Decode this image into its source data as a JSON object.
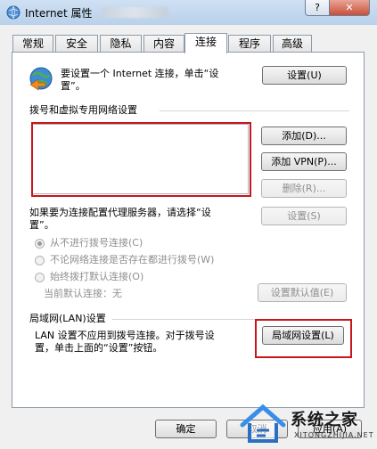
{
  "window": {
    "title": "Internet 属性",
    "help_label": "?",
    "close_label": "✕"
  },
  "tabs": [
    {
      "label": "常规"
    },
    {
      "label": "安全"
    },
    {
      "label": "隐私"
    },
    {
      "label": "内容"
    },
    {
      "label": "连接",
      "active": true
    },
    {
      "label": "程序"
    },
    {
      "label": "高级"
    }
  ],
  "setup": {
    "text_line1": "要设置一个 Internet 连接，单击“设",
    "text_line2": "置”。",
    "button": "设置(U)"
  },
  "dialup": {
    "heading": "拨号和虚拟专用网络设置",
    "add_button": "添加(D)...",
    "add_vpn_button": "添加 VPN(P)...",
    "remove_button": "删除(R)...",
    "proxy_text_line1": "如果要为连接配置代理服务器，请选择“设",
    "proxy_text_line2": "置”。",
    "settings_button": "设置(S)",
    "options": [
      {
        "label": "从不进行拨号连接(C)",
        "checked": true
      },
      {
        "label": "不论网络连接是否存在都进行拨号(W)",
        "checked": false
      },
      {
        "label": "始终拨打默认连接(O)",
        "checked": false
      }
    ],
    "current_default_label": "当前默认连接：",
    "current_default_value": "无",
    "set_default_button": "设置默认值(E)"
  },
  "lan": {
    "heading": "局域网(LAN)设置",
    "text_line1": "LAN 设置不应用到拨号连接。对于拨号设",
    "text_line2": "置，单击上面的“设置”按钮。",
    "button": "局域网设置(L)"
  },
  "footer": {
    "ok": "确定",
    "cancel": "取消",
    "apply": "应用(A)"
  },
  "watermark": {
    "text": "系统之家",
    "sub": "XITONGZHIJIA.NET"
  },
  "colors": {
    "highlight_red": "#c8161d",
    "title_gradient_top": "#cfe0f3",
    "close_red": "#c8503a"
  }
}
